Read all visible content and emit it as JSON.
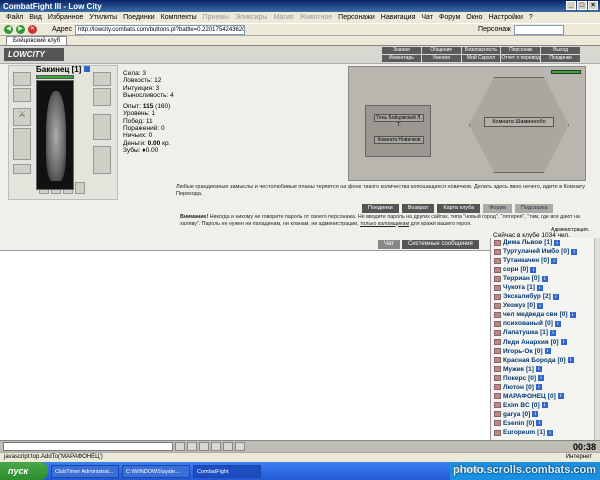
{
  "window": {
    "title": "CombatFight III - Low City"
  },
  "menubar": {
    "items": [
      "Файл",
      "Вид",
      "Избранное",
      "Утилиты",
      "Поединки",
      "Комплекты",
      "Приемы",
      "Эликсиры",
      "Магия",
      "Животное",
      "Персонажи",
      "Навигация",
      "Чат",
      "Форум",
      "Окно",
      "Настройки",
      "?"
    ],
    "disabled": [
      6,
      7,
      8,
      9
    ]
  },
  "addressbar": {
    "label": "Адрес",
    "url": "http://lowcity.combats.com/buttons.pl?battle=0.220175424362086",
    "search_label": "Персонаж"
  },
  "browser_tab": {
    "label": "Бойцовский клуб"
  },
  "site": {
    "logo": "LOWCITY",
    "topmenu": [
      "Знания",
      "Общение",
      "Безопасность",
      "Персонаж",
      "Выход",
      "Инвентарь",
      "Умения",
      "Мой Скролл",
      "Отчет о переводах",
      "Поединки"
    ],
    "topmenu_extra": "Клетка"
  },
  "character": {
    "name": "Бакинец",
    "level": "[1]",
    "stats": {
      "strength": "Сила: 3",
      "agility": "Ловкость: 12",
      "intuition": "Интуиция: 3",
      "endurance": "Выносливость: 4",
      "exp_label": "Опыт:",
      "exp_value": "115",
      "exp_next": "(160)",
      "level": "Уровень: 1",
      "wins": "Побед: 11",
      "losses": "Поражений: 0",
      "draws": "Ничьих: 0",
      "money_label": "Деньги:",
      "money_value": "0.00",
      "money_unit": "кр.",
      "teeth": "Зубы: ♦0.00"
    }
  },
  "map": {
    "plaque1": "Тень Бойцовский Л. Т.",
    "plaque2": "Комната Новичков",
    "hex_label": "Комната Шаминнобо"
  },
  "description": "Любые грандиозные замыслы и честолюбивые планы теряется на фоне такого количества копошащихся новичков. Делать здесь явно нечего, идите в Комнату Перехода.",
  "actions": [
    "Поединки",
    "Возврат",
    "Карта клуба",
    "Форум",
    "Подсказка"
  ],
  "warning": {
    "bold": "Внимание!",
    "text": " Никогда и никому не говорите пароль от своего персонажа. Не вводите пароль на других сайтах, типа \"новый город\", \"лотерея\", \"там, где все дают на халяву\". Пароль не нужен ни паладинам, ни кланам, ни администрации, ",
    "underlined": "только взломщикам",
    "tail": " для кражи вашего героя.",
    "admin": "Администрация."
  },
  "online": "Сейчас в клубе 1034 чел.",
  "chat_tabs": [
    "Чат",
    "Системные сообщения"
  ],
  "chat_users": [
    {
      "name": "Дима Львов",
      "level": "[1]"
    },
    {
      "name": "Туртулачей Имбо",
      "level": "[0]"
    },
    {
      "name": "Тутанкачен",
      "level": "[0]"
    },
    {
      "name": "сорн",
      "level": "[0]"
    },
    {
      "name": "Терриан",
      "level": "[0]"
    },
    {
      "name": "Чукота",
      "level": "[1]"
    },
    {
      "name": "Экскалибур",
      "level": "[2]"
    },
    {
      "name": "Укожуз",
      "level": "[0]"
    },
    {
      "name": "чел медведа сви",
      "level": "[0]"
    },
    {
      "name": "психованый",
      "level": "[0]"
    },
    {
      "name": "Лапатушка",
      "level": "[1]"
    },
    {
      "name": "Леди Анархия",
      "level": "[0]"
    },
    {
      "name": "Игорь-Ок",
      "level": "[0]"
    },
    {
      "name": "Красная Борода",
      "level": "[0]"
    },
    {
      "name": "Мужик",
      "level": "[1]"
    },
    {
      "name": "Покерс",
      "level": "[0]"
    },
    {
      "name": "Лютон",
      "level": "[0]"
    },
    {
      "name": "МАРАФОНЕЦ",
      "level": "[0]"
    },
    {
      "name": "Exim BC",
      "level": "[0]"
    },
    {
      "name": "garya",
      "level": "[0]"
    },
    {
      "name": "Esenin",
      "level": "[0]"
    },
    {
      "name": "Europeum",
      "level": "[1]"
    }
  ],
  "clock": "00:38",
  "statusbar": {
    "left": "javascript:top.AddTo('МАРАФОНЕЦ')",
    "right": "Интернет"
  },
  "taskbar": {
    "start": "пуск",
    "tasks": [
      "ClubTimer Administrat...",
      "C:\\WINDOWS\\syste...",
      "CombatFight"
    ],
    "tray": "Ln 34/M: 0"
  },
  "watermark": "photo.scrolls.combats.com"
}
